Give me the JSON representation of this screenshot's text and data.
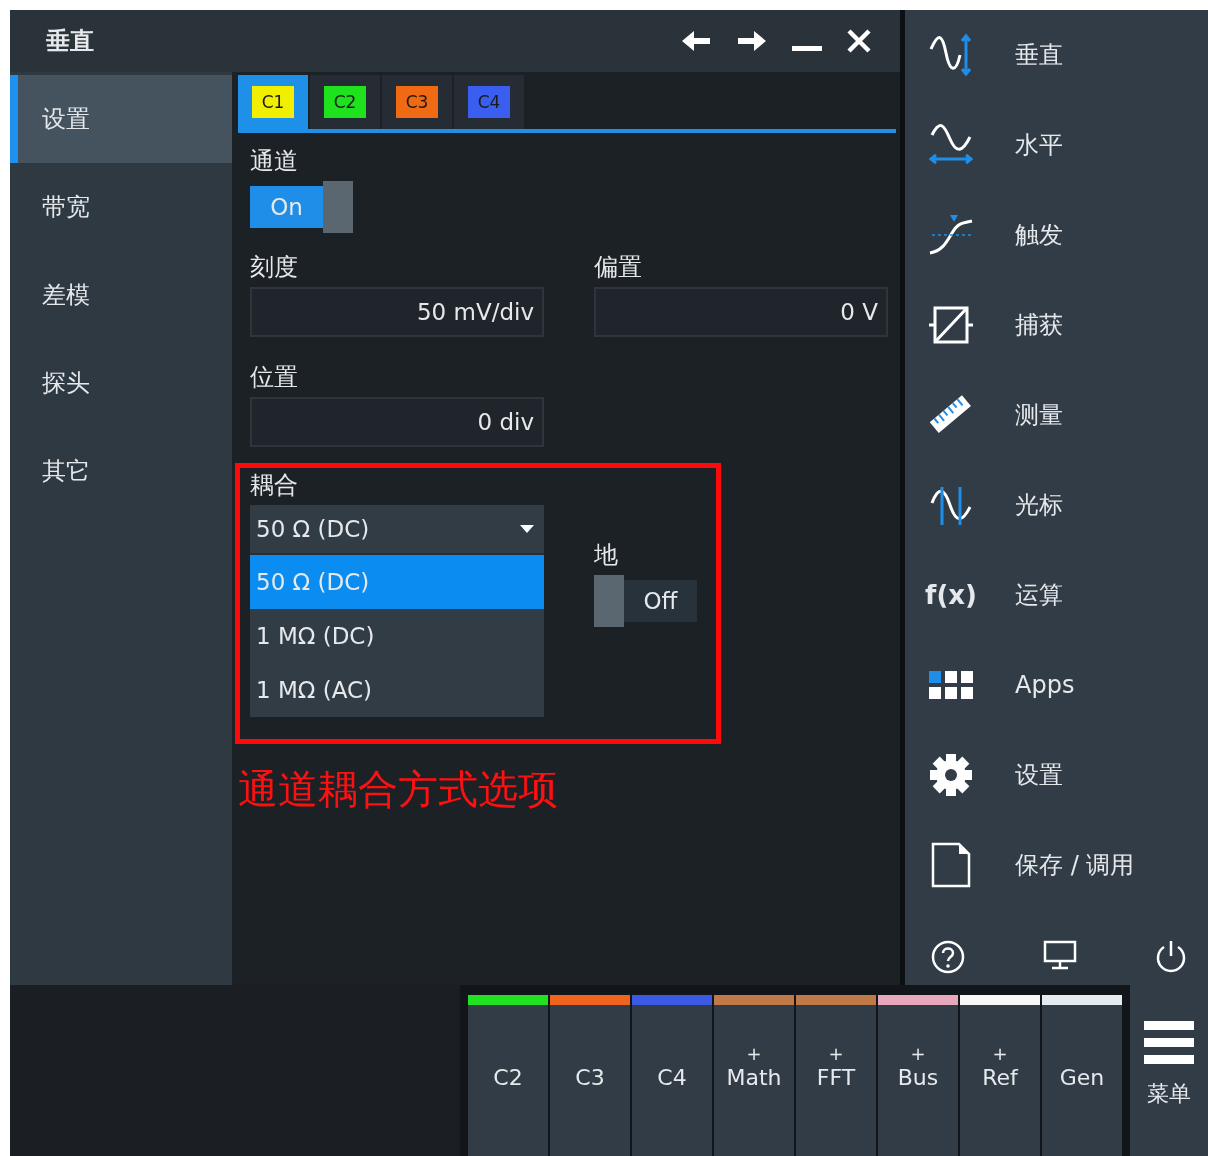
{
  "dialog": {
    "title": "垂直"
  },
  "nav": [
    {
      "label": "设置",
      "selected": true
    },
    {
      "label": "带宽",
      "selected": false
    },
    {
      "label": "差模",
      "selected": false
    },
    {
      "label": "探头",
      "selected": false
    },
    {
      "label": "其它",
      "selected": false
    }
  ],
  "channel_tabs": [
    {
      "label": "C1",
      "color": "#f2ee00",
      "selected": true
    },
    {
      "label": "C2",
      "color": "#1ee21e",
      "selected": false
    },
    {
      "label": "C3",
      "color": "#f06a14",
      "selected": false
    },
    {
      "label": "C4",
      "color": "#3a5ef0",
      "selected": false
    }
  ],
  "channel": {
    "label": "通道",
    "value": "On",
    "on": true
  },
  "scale": {
    "label": "刻度",
    "value": "50 mV/div"
  },
  "offset": {
    "label": "偏置",
    "value": "0 V"
  },
  "position": {
    "label": "位置",
    "value": "0 div"
  },
  "coupling": {
    "label": "耦合",
    "value": "50 Ω (DC)",
    "expanded": true,
    "options": [
      {
        "label": "50 Ω (DC)",
        "selected": true
      },
      {
        "label": "1 MΩ (DC)",
        "selected": false
      },
      {
        "label": "1 MΩ (AC)",
        "selected": false
      }
    ]
  },
  "ground": {
    "label": "地",
    "value": "Off",
    "on": false
  },
  "annotation": "通道耦合方式选项",
  "toolbar": [
    {
      "label": "垂直"
    },
    {
      "label": "水平"
    },
    {
      "label": "触发"
    },
    {
      "label": "捕获"
    },
    {
      "label": "测量"
    },
    {
      "label": "光标"
    },
    {
      "label": "运算",
      "icon_text": "f(x)"
    },
    {
      "label": "Apps"
    },
    {
      "label": "设置"
    },
    {
      "label": "保存 / 调用"
    }
  ],
  "signal_bar": [
    {
      "label": "C2",
      "color": "#22e022"
    },
    {
      "label": "C3",
      "color": "#f0641e"
    },
    {
      "label": "C4",
      "color": "#3c5ae6"
    },
    {
      "label": "Math",
      "add": "+",
      "color": "#c07a48"
    },
    {
      "label": "FFT",
      "add": "+",
      "color": "#c07a48"
    },
    {
      "label": "Bus",
      "add": "+",
      "color": "#e8a8bc"
    },
    {
      "label": "Ref",
      "add": "+",
      "color": "#f8f8f8"
    },
    {
      "label": "Gen",
      "color": "#e4ecf0"
    }
  ],
  "menu": {
    "label": "菜单"
  }
}
